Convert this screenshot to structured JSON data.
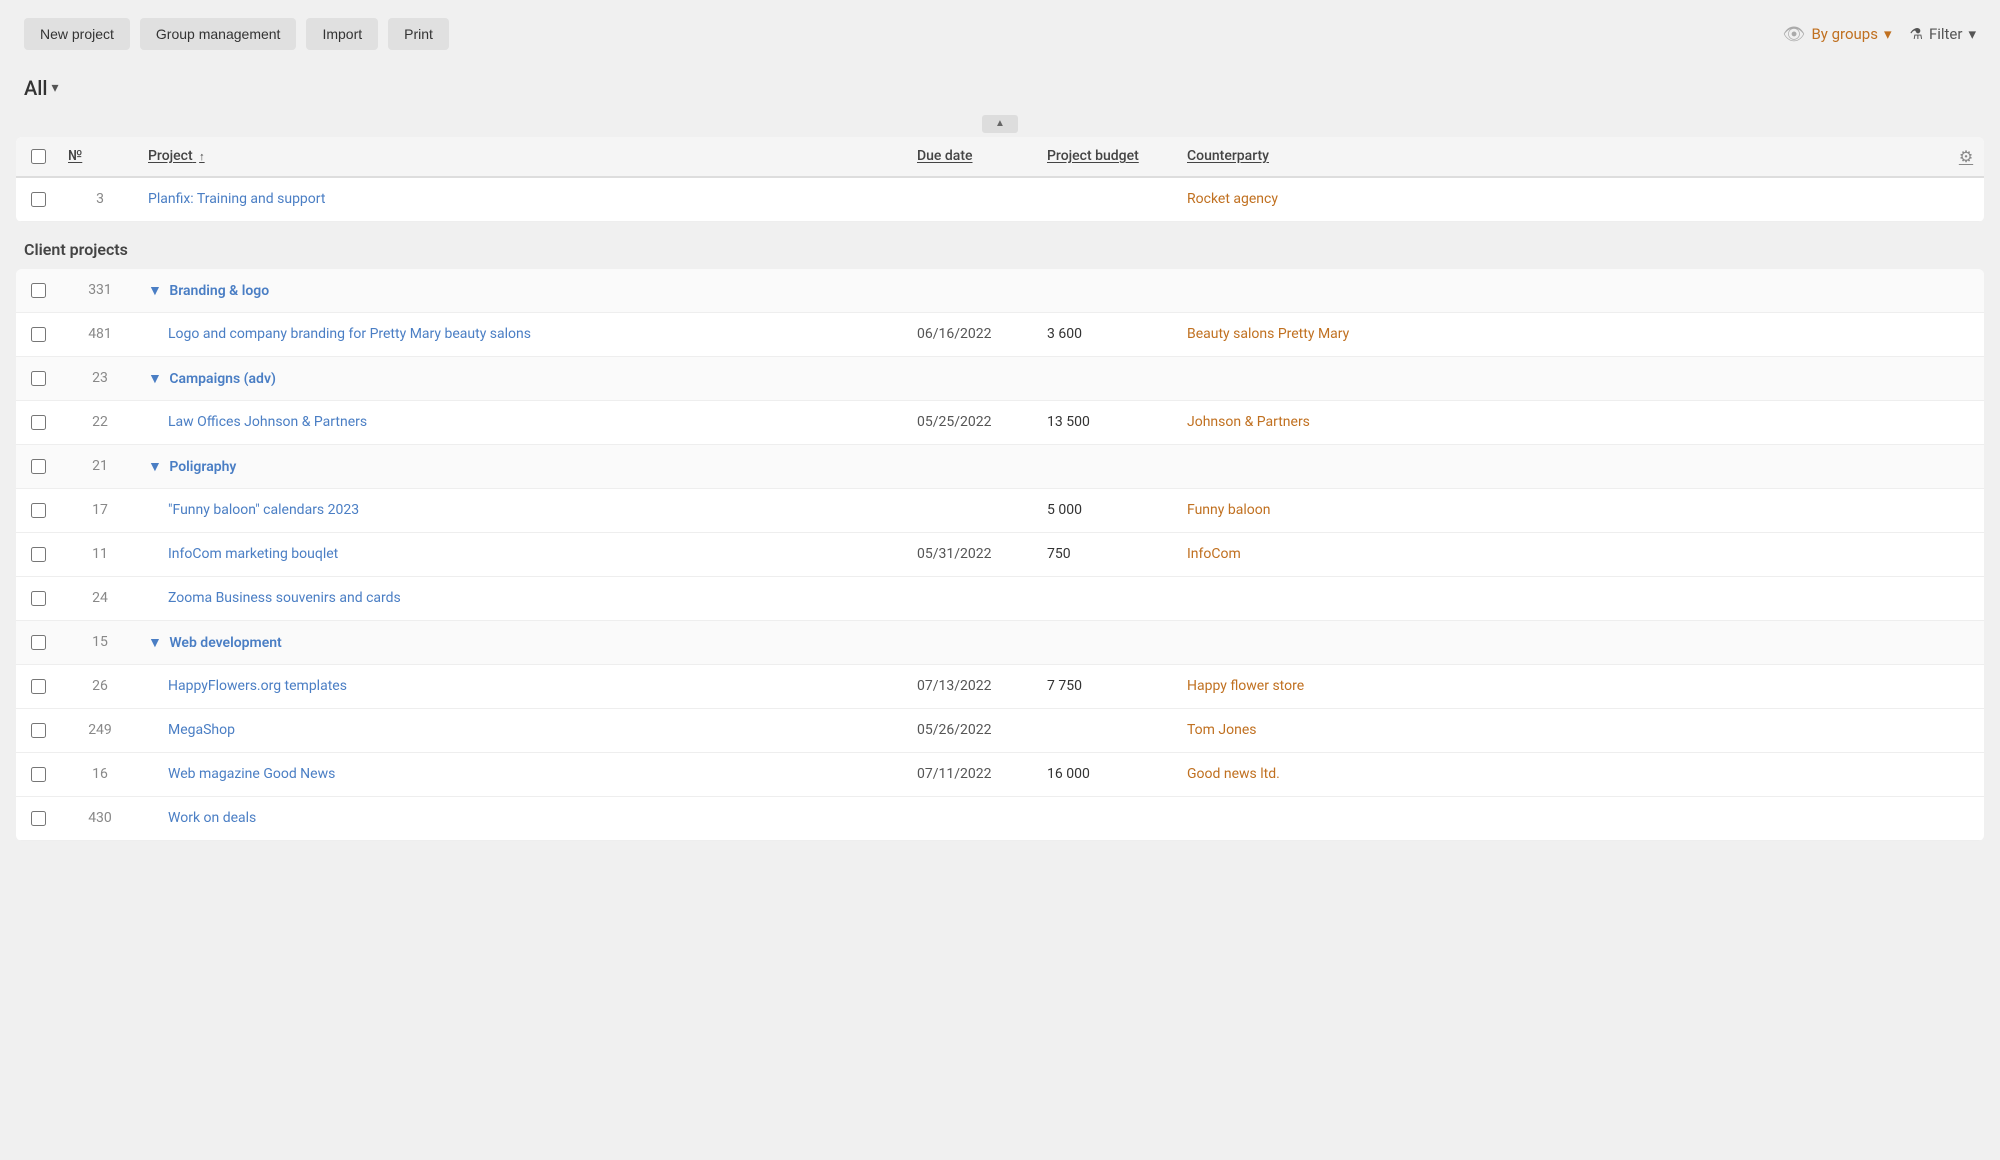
{
  "toolbar": {
    "buttons": [
      {
        "label": "New project",
        "name": "new-project-button"
      },
      {
        "label": "Group management",
        "name": "group-management-button"
      },
      {
        "label": "Import",
        "name": "import-button"
      },
      {
        "label": "Print",
        "name": "print-button"
      }
    ]
  },
  "view": {
    "all_label": "All",
    "by_groups_label": "By groups",
    "filter_label": "Filter"
  },
  "table": {
    "columns": [
      {
        "label": "№",
        "name": "col-number"
      },
      {
        "label": "Project",
        "name": "col-project",
        "sort": "↑"
      },
      {
        "label": "Due date",
        "name": "col-due-date"
      },
      {
        "label": "Project budget",
        "name": "col-budget"
      },
      {
        "label": "Counterparty",
        "name": "col-counterparty"
      }
    ]
  },
  "top_rows": [
    {
      "id": "3",
      "project": "Planfix: Training and support",
      "due_date": "",
      "budget": "",
      "counterparty": "Rocket agency"
    }
  ],
  "groups": [
    {
      "name": "Client projects",
      "subgroups": [
        {
          "name": "Branding & logo",
          "id": "331",
          "rows": [
            {
              "id": "481",
              "project": "Logo and company branding for Pretty Mary beauty salons",
              "due_date": "06/16/2022",
              "budget": "3 600",
              "counterparty": "Beauty salons Pretty Mary"
            }
          ]
        },
        {
          "name": "Campaigns (adv)",
          "id": "23",
          "rows": [
            {
              "id": "22",
              "project": "Law Offices Johnson & Partners",
              "due_date": "05/25/2022",
              "budget": "13 500",
              "counterparty": "Johnson & Partners"
            }
          ]
        },
        {
          "name": "Poligraphy",
          "id": "21",
          "rows": [
            {
              "id": "17",
              "project": "\"Funny baloon\" calendars 2023",
              "due_date": "",
              "budget": "5 000",
              "counterparty": "Funny baloon"
            },
            {
              "id": "11",
              "project": "InfoCom marketing bouqlet",
              "due_date": "05/31/2022",
              "budget": "750",
              "counterparty": "InfoCom"
            },
            {
              "id": "24",
              "project": "Zooma Business souvenirs and cards",
              "due_date": "",
              "budget": "",
              "counterparty": ""
            }
          ]
        },
        {
          "name": "Web development",
          "id": "15",
          "rows": [
            {
              "id": "26",
              "project": "HappyFlowers.org templates",
              "due_date": "07/13/2022",
              "budget": "7 750",
              "counterparty": "Happy flower store"
            },
            {
              "id": "249",
              "project": "MegaShop",
              "due_date": "05/26/2022",
              "budget": "",
              "counterparty": "Tom Jones"
            },
            {
              "id": "16",
              "project": "Web magazine Good News",
              "due_date": "07/11/2022",
              "budget": "16 000",
              "counterparty": "Good news ltd."
            },
            {
              "id": "430",
              "project": "Work on deals",
              "due_date": "",
              "budget": "",
              "counterparty": ""
            }
          ]
        }
      ]
    }
  ]
}
